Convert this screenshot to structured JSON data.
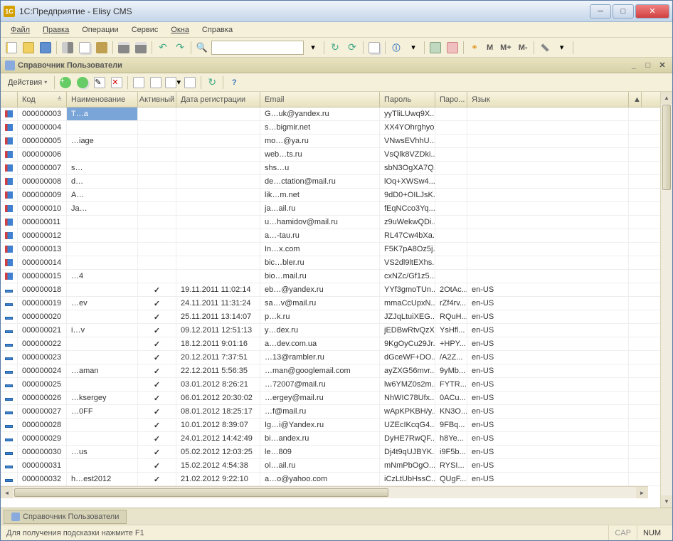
{
  "window": {
    "title": "1С:Предприятие - Elisy CMS"
  },
  "menu": {
    "file": "Файл",
    "edit": "Правка",
    "operations": "Операции",
    "service": "Сервис",
    "windows": "Окна",
    "help": "Справка"
  },
  "panel": {
    "title": "Справочник Пользователи"
  },
  "actions": {
    "label": "Действия"
  },
  "columns": {
    "code": "Код",
    "name": "Наименование",
    "active": "Активный",
    "date": "Дата регистрации",
    "email": "Email",
    "pass": "Пароль",
    "pass2": "Паро...",
    "lang": "Язык"
  },
  "rows": [
    {
      "i": "r",
      "code": "000000003",
      "name": "T…a",
      "active": "",
      "date": "",
      "email": "G…uk@yandex.ru",
      "pass": "yyTliLUwq9X...",
      "pass2": "",
      "lang": "",
      "sel": true
    },
    {
      "i": "r",
      "code": "000000004",
      "name": "",
      "active": "",
      "date": "",
      "email": "s…bigmir.net",
      "pass": "XX4YOhrghyo...",
      "pass2": "",
      "lang": ""
    },
    {
      "i": "r",
      "code": "000000005",
      "name": "…iage",
      "active": "",
      "date": "",
      "email": "mo…@ya.ru",
      "pass": "VNwsEVhhU...",
      "pass2": "",
      "lang": ""
    },
    {
      "i": "r",
      "code": "000000006",
      "name": "",
      "active": "",
      "date": "",
      "email": "web…ts.ru",
      "pass": "VsQlk8VZDki...",
      "pass2": "",
      "lang": ""
    },
    {
      "i": "r",
      "code": "000000007",
      "name": "s…",
      "active": "",
      "date": "",
      "email": "shs…u",
      "pass": "sbN3OgXA7Q...",
      "pass2": "",
      "lang": ""
    },
    {
      "i": "r",
      "code": "000000008",
      "name": "d…",
      "active": "",
      "date": "",
      "email": "de…ctation@mail.ru",
      "pass": "lOq+XWSw4...",
      "pass2": "",
      "lang": ""
    },
    {
      "i": "r",
      "code": "000000009",
      "name": "A…",
      "active": "",
      "date": "",
      "email": "lik…m.net",
      "pass": "9dD0+OILJsK...",
      "pass2": "",
      "lang": ""
    },
    {
      "i": "r",
      "code": "000000010",
      "name": "Ja…",
      "active": "",
      "date": "",
      "email": "ja…ail.ru",
      "pass": "fEqNCco3Yq...",
      "pass2": "",
      "lang": ""
    },
    {
      "i": "r",
      "code": "000000011",
      "name": "",
      "active": "",
      "date": "",
      "email": "u…hamidov@mail.ru",
      "pass": "z9uWekwQDi...",
      "pass2": "",
      "lang": ""
    },
    {
      "i": "r",
      "code": "000000012",
      "name": "",
      "active": "",
      "date": "",
      "email": "a…-tau.ru",
      "pass": "RL47Cw4bXa...",
      "pass2": "",
      "lang": ""
    },
    {
      "i": "r",
      "code": "000000013",
      "name": "",
      "active": "",
      "date": "",
      "email": "In…x.com",
      "pass": "F5K7pA8Oz5j...",
      "pass2": "",
      "lang": ""
    },
    {
      "i": "r",
      "code": "000000014",
      "name": "",
      "active": "",
      "date": "",
      "email": "bic…bler.ru",
      "pass": "VS2dl9ltEXhs...",
      "pass2": "",
      "lang": ""
    },
    {
      "i": "r",
      "code": "000000015",
      "name": "…4",
      "active": "",
      "date": "",
      "email": "bio…mail.ru",
      "pass": "cxNZc/Gf1z5...",
      "pass2": "",
      "lang": ""
    },
    {
      "i": "b",
      "code": "000000018",
      "name": "",
      "active": "✓",
      "date": "19.11.2011 11:02:14",
      "email": "eb…@yandex.ru",
      "pass": "YYf3gmoTUn...",
      "pass2": "2OtAc...",
      "lang": "en-US"
    },
    {
      "i": "b",
      "code": "000000019",
      "name": "…ev",
      "active": "✓",
      "date": "24.11.2011 11:31:24",
      "email": "sa…v@mail.ru",
      "pass": "mmaCcUpxN...",
      "pass2": "rZf4rv...",
      "lang": "en-US"
    },
    {
      "i": "b",
      "code": "000000020",
      "name": "",
      "active": "✓",
      "date": "25.11.2011 13:14:07",
      "email": "p…k.ru",
      "pass": "JZJqLtuiXEG...",
      "pass2": "RQuH...",
      "lang": "en-US"
    },
    {
      "i": "b",
      "code": "000000021",
      "name": "i…v",
      "active": "✓",
      "date": "09.12.2011 12:51:13",
      "email": "y…dex.ru",
      "pass": "jEDBwRtvQzX...",
      "pass2": "YsHfl...",
      "lang": "en-US"
    },
    {
      "i": "b",
      "code": "000000022",
      "name": "",
      "active": "✓",
      "date": "18.12.2011 9:01:16",
      "email": "a…dev.com.ua",
      "pass": "9KgOyCu29Jr...",
      "pass2": "+HPY...",
      "lang": "en-US"
    },
    {
      "i": "b",
      "code": "000000023",
      "name": "",
      "active": "✓",
      "date": "20.12.2011 7:37:51",
      "email": "…13@rambler.ru",
      "pass": "dGceWF+DO...",
      "pass2": "/A2Z...",
      "lang": "en-US"
    },
    {
      "i": "b",
      "code": "000000024",
      "name": "…aman",
      "active": "✓",
      "date": "22.12.2011 5:56:35",
      "email": "…man@googlemail.com",
      "pass": "ayZXG56mvr...",
      "pass2": "9yMb...",
      "lang": "en-US"
    },
    {
      "i": "b",
      "code": "000000025",
      "name": "",
      "active": "✓",
      "date": "03.01.2012 8:26:21",
      "email": "…72007@mail.ru",
      "pass": "lw6YMZ0s2m...",
      "pass2": "FYTR...",
      "lang": "en-US"
    },
    {
      "i": "b",
      "code": "000000026",
      "name": "…ksergey",
      "active": "✓",
      "date": "06.01.2012 20:30:02",
      "email": "…ergey@mail.ru",
      "pass": "NhWIC78Ufx...",
      "pass2": "0ACu...",
      "lang": "en-US"
    },
    {
      "i": "b",
      "code": "000000027",
      "name": "…0FF",
      "active": "✓",
      "date": "08.01.2012 18:25:17",
      "email": "…f@mail.ru",
      "pass": "wApKPKBH/y...",
      "pass2": "KN3O...",
      "lang": "en-US"
    },
    {
      "i": "b",
      "code": "000000028",
      "name": "",
      "active": "✓",
      "date": "10.01.2012 8:39:07",
      "email": "Ig…i@Yandex.ru",
      "pass": "UZEcIKcqG4...",
      "pass2": "9FBq...",
      "lang": "en-US"
    },
    {
      "i": "b",
      "code": "000000029",
      "name": "",
      "active": "✓",
      "date": "24.01.2012 14:42:49",
      "email": "bi…andex.ru",
      "pass": "DyHE7RwQF...",
      "pass2": "h8Ye...",
      "lang": "en-US"
    },
    {
      "i": "b",
      "code": "000000030",
      "name": "…us",
      "active": "✓",
      "date": "05.02.2012 12:03:25",
      "email": "le…809",
      "pass": "Dj4t9qUJBYK...",
      "pass2": "i9F5b...",
      "lang": "en-US"
    },
    {
      "i": "b",
      "code": "000000031",
      "name": "",
      "active": "✓",
      "date": "15.02.2012 4:54:38",
      "email": "ol…ail.ru",
      "pass": "mNmPbOgO...",
      "pass2": "RYSI...",
      "lang": "en-US"
    },
    {
      "i": "b",
      "code": "000000032",
      "name": "h…est2012",
      "active": "✓",
      "date": "21.02.2012 9:22:10",
      "email": "a…o@yahoo.com",
      "pass": "iCzLtUbHssC...",
      "pass2": "QUgF...",
      "lang": "en-US"
    }
  ],
  "tab": {
    "label": "Справочник Пользователи"
  },
  "status": {
    "hint": "Для получения подсказки нажмите F1",
    "cap": "CAP",
    "num": "NUM"
  },
  "toolbar": {
    "m": "M",
    "mplus": "M+",
    "mminus": "M-"
  }
}
